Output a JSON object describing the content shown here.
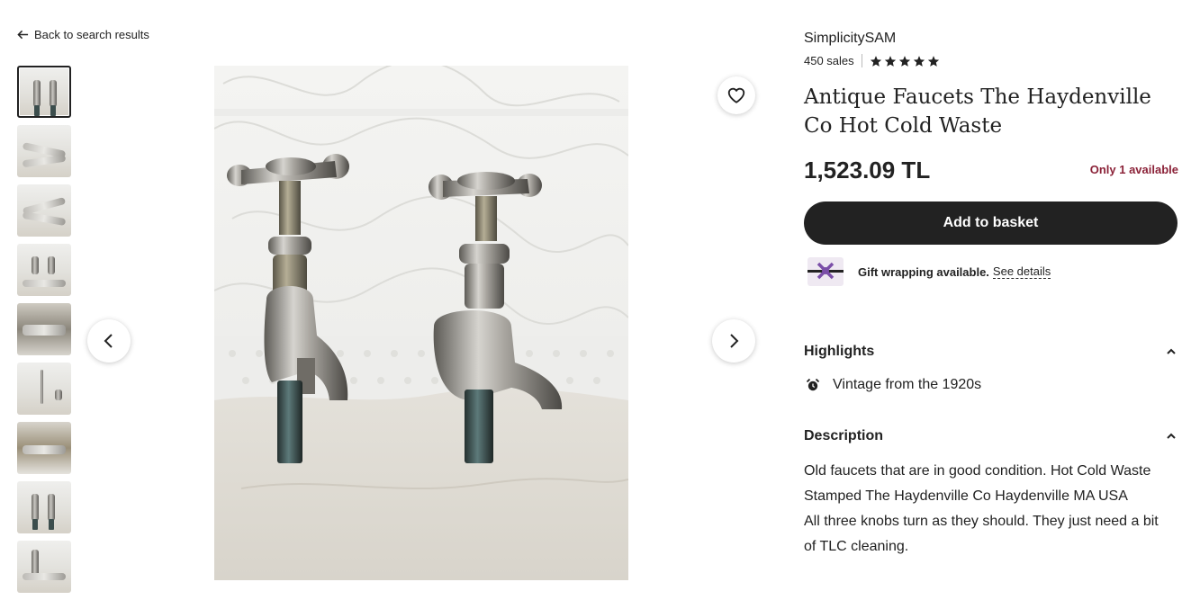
{
  "back_link": {
    "label": "Back to search results",
    "icon": "arrow-left-icon"
  },
  "gallery": {
    "thumbnail_count": 9,
    "selected_index": 0,
    "prev_icon": "chevron-left-icon",
    "next_icon": "chevron-right-icon",
    "favorite_icon": "heart-icon"
  },
  "shop": {
    "name": "SimplicitySAM",
    "sales": "450 sales",
    "rating": 5
  },
  "product": {
    "title": "Antique Faucets The Haydenville Co Hot Cold Waste",
    "price": "1,523.09 TL",
    "stock": "Only 1 available"
  },
  "actions": {
    "add_to_basket": "Add to basket"
  },
  "gift": {
    "text": "Gift wrapping available.",
    "link": "See details",
    "icon": "gift-icon"
  },
  "highlights": {
    "heading": "Highlights",
    "items": [
      {
        "icon": "alarm-clock-icon",
        "text": "Vintage from the 1920s"
      }
    ]
  },
  "description": {
    "heading": "Description",
    "lines": [
      "Old faucets that are in good condition. Hot Cold Waste",
      "Stamped The Haydenville Co Haydenville MA USA",
      "All three knobs turn as they should. They just need a bit of TLC cleaning."
    ]
  },
  "colors": {
    "primary_button": "#222222",
    "stock_text": "#8b2238",
    "gift_icon": "#7b4fa8"
  }
}
